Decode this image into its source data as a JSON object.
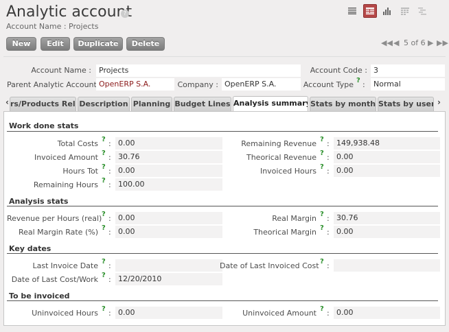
{
  "header": {
    "title": "Analytic account",
    "help_badge": "?",
    "breadcrumb": "Account Name : Projects"
  },
  "view_switcher": {
    "views": [
      "list-view-icon",
      "form-view-icon",
      "graph-view-icon",
      "calendar-view-icon",
      "gantt-view-icon"
    ],
    "active": "form-view-icon"
  },
  "toolbar": {
    "new_label": "New",
    "edit_label": "Edit",
    "duplicate_label": "Duplicate",
    "delete_label": "Delete"
  },
  "pager": {
    "text": "5 of 6"
  },
  "header_fields": {
    "account_name_label": "Account Name :",
    "account_name": "Projects",
    "account_code_label": "Account Code :",
    "account_code": "3",
    "parent_label": "Parent Analytic Account :",
    "parent": "OpenERP S.A.",
    "company_label": "Company :",
    "company": "OpenERP S.A.",
    "account_type_label": "Account Type",
    "account_type": "Normal",
    "help_mark": "?",
    "colon": ":"
  },
  "tabs": [
    {
      "label": "rs/Products Rel."
    },
    {
      "label": "Description"
    },
    {
      "label": "Planning"
    },
    {
      "label": "Budget Lines"
    },
    {
      "label": "Analysis summary"
    },
    {
      "label": "Stats by month"
    },
    {
      "label": "Stats by user"
    }
  ],
  "active_tab": "Analysis summary",
  "work_done": {
    "title": "Work done stats",
    "total_costs_label": "Total Costs",
    "total_costs": "0.00",
    "invoiced_amount_label": "Invoiced Amount",
    "invoiced_amount": "30.76",
    "hours_tot_label": "Hours Tot",
    "hours_tot": "0.00",
    "remaining_hours_label": "Remaining Hours",
    "remaining_hours": "100.00",
    "remaining_revenue_label": "Remaining Revenue",
    "remaining_revenue": "149,938.48",
    "theorical_revenue_label": "Theorical Revenue",
    "theorical_revenue": "0.00",
    "invoiced_hours_label": "Invoiced Hours",
    "invoiced_hours": "0.00"
  },
  "analysis": {
    "title": "Analysis stats",
    "revenue_per_hours_label": "Revenue per Hours (real)",
    "revenue_per_hours": "0.00",
    "real_margin_rate_label": "Real Margin Rate (%)",
    "real_margin_rate": "0.00",
    "real_margin_label": "Real Margin",
    "real_margin": "30.76",
    "theorical_margin_label": "Theorical Margin",
    "theorical_margin": "0.00"
  },
  "key_dates": {
    "title": "Key dates",
    "last_invoice_date_label": "Last Invoice Date",
    "last_invoice_date": "",
    "last_cost_work_label": "Date of Last Cost/Work",
    "last_cost_work": "12/20/2010",
    "last_invoiced_cost_label": "Date of Last Invoiced Cost",
    "last_invoiced_cost": ""
  },
  "to_invoice": {
    "title": "To be invoiced",
    "uninvoiced_hours_label": "Uninvoiced Hours",
    "uninvoiced_hours": "0.00",
    "uninvoiced_amount_label": "Uninvoiced Amount",
    "uninvoiced_amount": "0.00"
  },
  "colors": {
    "accent": "#b54848",
    "link": "#8b1a1a",
    "help_mark": "#2a8f2a"
  }
}
